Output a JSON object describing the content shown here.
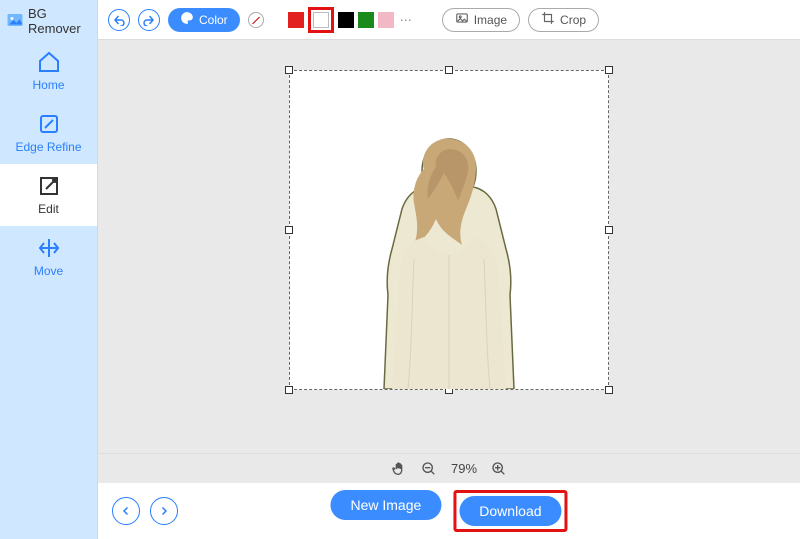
{
  "app": {
    "title": "BG Remover"
  },
  "sidebar": {
    "items": [
      {
        "label": "Home"
      },
      {
        "label": "Edge Refine"
      },
      {
        "label": "Edit"
      },
      {
        "label": "Move"
      }
    ]
  },
  "toolbar": {
    "color_label": "Color",
    "image_label": "Image",
    "crop_label": "Crop",
    "swatches": {
      "blue": "#1a3fd6",
      "red": "#e22020",
      "white": "#ffffff",
      "black": "#000000",
      "green": "#1a8a1a",
      "pink": "#f2b8c6"
    }
  },
  "zoom": {
    "percent_label": "79%"
  },
  "bottom": {
    "new_image_label": "New Image",
    "download_label": "Download"
  }
}
